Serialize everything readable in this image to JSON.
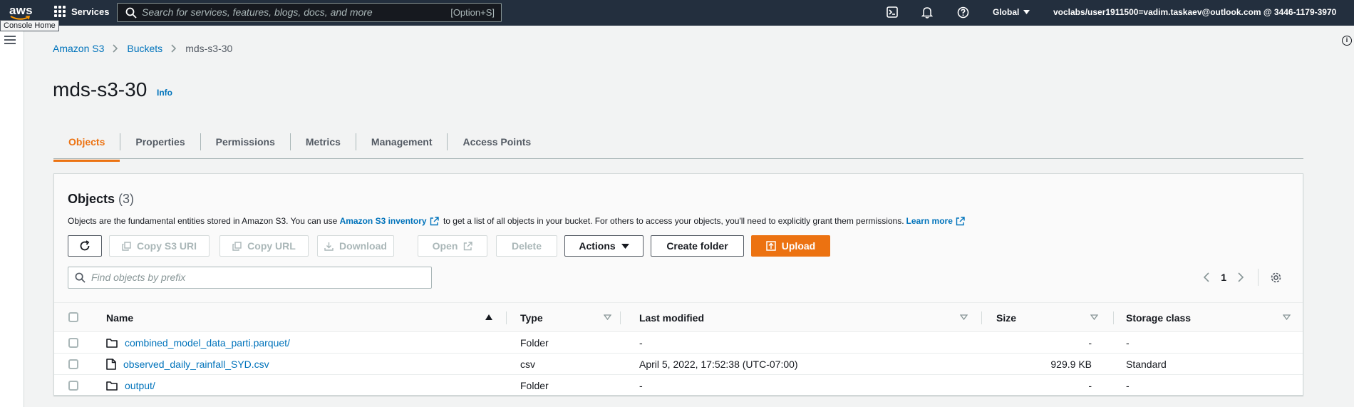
{
  "topnav": {
    "logo_text": "aws",
    "services_label": "Services",
    "search_placeholder": "Search for services, features, blogs, docs, and more",
    "search_shortcut": "[Option+S]",
    "region": "Global",
    "account": "voclabs/user1911500=vadim.taskaev@outlook.com @ 3446-1179-3970",
    "tooltip": "Console Home"
  },
  "breadcrumb": [
    "Amazon S3",
    "Buckets",
    "mds-s3-30"
  ],
  "page": {
    "title": "mds-s3-30",
    "info": "Info"
  },
  "tabs": [
    "Objects",
    "Properties",
    "Permissions",
    "Metrics",
    "Management",
    "Access Points"
  ],
  "panel": {
    "title": "Objects",
    "count": "(3)",
    "desc_prefix": "Objects are the fundamental entities stored in Amazon S3. You can use ",
    "desc_link": "Amazon S3 inventory",
    "desc_middle": " to get a list of all objects in your bucket. For others to access your objects, you'll need to explicitly grant them permissions.",
    "learn_more": "Learn more",
    "buttons": {
      "copy_s3_uri": "Copy S3 URI",
      "copy_url": "Copy URL",
      "download": "Download",
      "open": "Open",
      "delete": "Delete",
      "actions": "Actions",
      "create_folder": "Create folder",
      "upload": "Upload"
    },
    "filter_placeholder": "Find objects by prefix",
    "page_number": "1"
  },
  "table": {
    "columns": [
      "Name",
      "Type",
      "Last modified",
      "Size",
      "Storage class"
    ],
    "rows": [
      {
        "name": "combined_model_data_parti.parquet/",
        "type": "Folder",
        "modified": "-",
        "size": "-",
        "storage": "-",
        "kind": "folder"
      },
      {
        "name": "observed_daily_rainfall_SYD.csv",
        "type": "csv",
        "modified": "April 5, 2022, 17:52:38 (UTC-07:00)",
        "size": "929.9 KB",
        "storage": "Standard",
        "kind": "file"
      },
      {
        "name": "output/",
        "type": "Folder",
        "modified": "-",
        "size": "-",
        "storage": "-",
        "kind": "folder"
      }
    ]
  },
  "colors": {
    "accent": "#ec7211",
    "link": "#0073bb",
    "nav": "#232f3e"
  }
}
